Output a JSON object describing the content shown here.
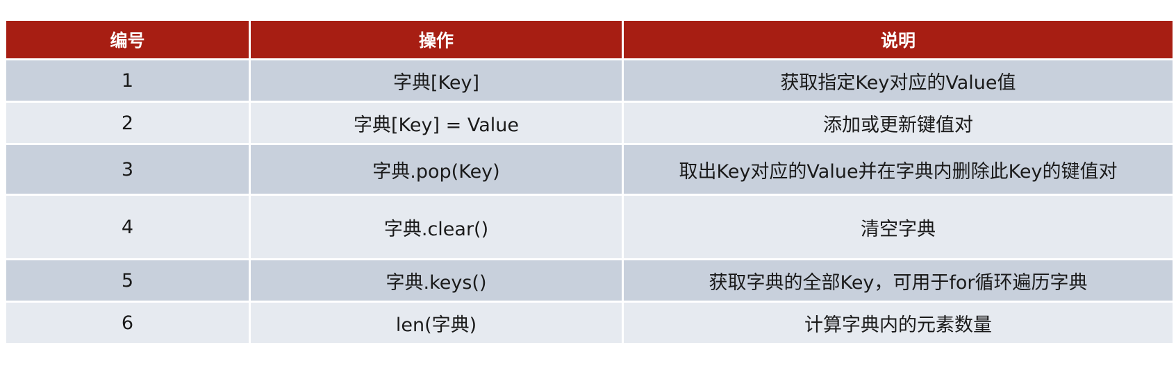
{
  "table": {
    "headers": [
      "编号",
      "操作",
      "说明"
    ],
    "rows": [
      {
        "no": "1",
        "op": "字典[Key]",
        "desc": "获取指定Key对应的Value值"
      },
      {
        "no": "2",
        "op": "字典[Key] = Value",
        "desc": "添加或更新键值对"
      },
      {
        "no": "3",
        "op": "字典.pop(Key)",
        "desc": "取出Key对应的Value并在字典内删除此Key的键值对"
      },
      {
        "no": "4",
        "op": "字典.clear()",
        "desc": "清空字典"
      },
      {
        "no": "5",
        "op": "字典.keys()",
        "desc": "获取字典的全部Key，可用于for循环遍历字典"
      },
      {
        "no": "6",
        "op": "len(字典)",
        "desc": "计算字典内的元素数量"
      }
    ]
  },
  "colors": {
    "header_bg": "#a71e13",
    "header_text": "#ffffff",
    "row_dark": "#c8d0dc",
    "row_light": "#e6eaf0"
  }
}
